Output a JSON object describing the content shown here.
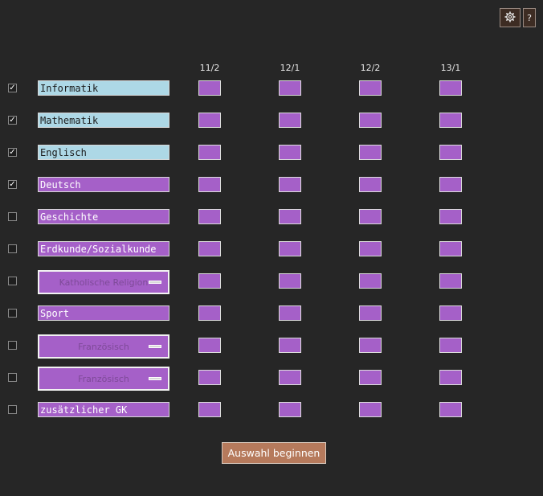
{
  "toolbar": {
    "settings_icon": "gear-icon",
    "help_label": "?"
  },
  "columns": [
    "11/2",
    "12/1",
    "12/2",
    "13/1"
  ],
  "subjects": [
    {
      "label": "Informatik",
      "checked": true,
      "kind": "field",
      "color": "#add8e6"
    },
    {
      "label": "Mathematik",
      "checked": true,
      "kind": "field",
      "color": "#add8e6"
    },
    {
      "label": "Englisch",
      "checked": true,
      "kind": "field",
      "color": "#add8e6"
    },
    {
      "label": "Deutsch",
      "checked": true,
      "kind": "field",
      "color": "#a560c8"
    },
    {
      "label": "Geschichte",
      "checked": false,
      "kind": "field",
      "color": "#a560c8"
    },
    {
      "label": "Erdkunde/Sozialkunde",
      "checked": false,
      "kind": "field",
      "color": "#a560c8"
    },
    {
      "label": "Katholische Religion",
      "checked": false,
      "kind": "dropdown",
      "color": "#a560c8"
    },
    {
      "label": "Sport",
      "checked": false,
      "kind": "field",
      "color": "#a560c8"
    },
    {
      "label": "Französisch",
      "checked": false,
      "kind": "dropdown",
      "color": "#a560c8"
    },
    {
      "label": "Französisch",
      "checked": false,
      "kind": "dropdown",
      "color": "#a560c8"
    },
    {
      "label": "zusätzlicher GK",
      "checked": false,
      "kind": "field",
      "color": "#a560c8"
    }
  ],
  "checkmark": "✓",
  "start_button": "Auswahl beginnen",
  "colors": {
    "background": "#262626",
    "core_subject": "#add8e6",
    "elective": "#a560c8",
    "button": "#b67a5c"
  }
}
